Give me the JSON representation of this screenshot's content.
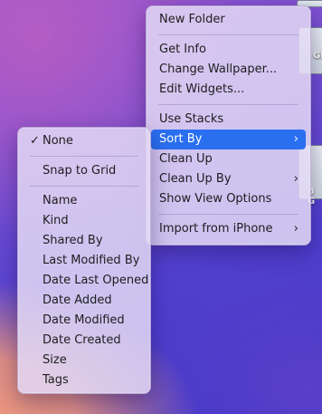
{
  "desktop": {
    "icon_label_1": "GE",
    "icon_label_2": "B G"
  },
  "context_menu": {
    "items": [
      {
        "label": "New Folder"
      },
      {
        "label": "Get Info"
      },
      {
        "label": "Change Wallpaper..."
      },
      {
        "label": "Edit Widgets..."
      },
      {
        "label": "Use Stacks"
      },
      {
        "label": "Sort By",
        "chevron": "›",
        "highlighted": true
      },
      {
        "label": "Clean Up"
      },
      {
        "label": "Clean Up By",
        "chevron": "›"
      },
      {
        "label": "Show View Options"
      },
      {
        "label": "Import from iPhone",
        "chevron": "›"
      }
    ]
  },
  "sort_submenu": {
    "check_mark": "✓",
    "items": [
      {
        "label": "None",
        "checked": true
      },
      {
        "label": "Snap to Grid"
      },
      {
        "label": "Name"
      },
      {
        "label": "Kind"
      },
      {
        "label": "Shared By"
      },
      {
        "label": "Last Modified By"
      },
      {
        "label": "Date Last Opened"
      },
      {
        "label": "Date Added"
      },
      {
        "label": "Date Modified"
      },
      {
        "label": "Date Created"
      },
      {
        "label": "Size"
      },
      {
        "label": "Tags"
      }
    ]
  },
  "colors": {
    "highlight": "#2a6ff0",
    "menu_background": "#e2d8f5"
  }
}
